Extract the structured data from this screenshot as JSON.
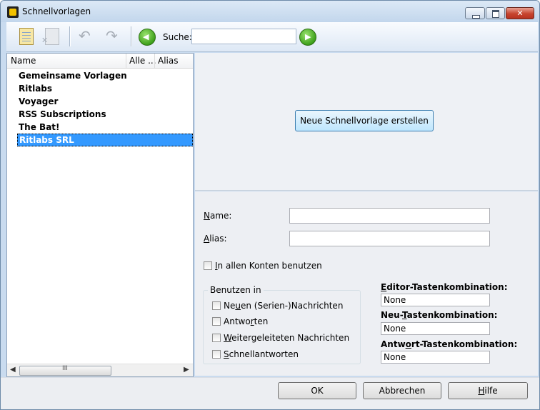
{
  "window": {
    "title": "Schnellvorlagen"
  },
  "toolbar": {
    "search_label": "Suche:",
    "search_value": ""
  },
  "columns": [
    "Name",
    "Alle ...",
    "Alias"
  ],
  "tree": [
    {
      "label": "Gemeinsame Vorlagen",
      "selected": false
    },
    {
      "label": "Ritlabs",
      "selected": false
    },
    {
      "label": "Voyager",
      "selected": false
    },
    {
      "label": "RSS Subscriptions",
      "selected": false
    },
    {
      "label": "The Bat!",
      "selected": false
    },
    {
      "label": "Ritlabs SRL",
      "selected": true
    }
  ],
  "scrollbar": {
    "grip": "III"
  },
  "create_button": "Neue Schnellvorlage erstellen",
  "form": {
    "name_label": "Name:",
    "name_value": "",
    "alias_label": "Alias:",
    "alias_value": "",
    "all_accounts": {
      "label": "In allen Konten benutzen",
      "checked": false
    },
    "use_in_title": "Benutzen in",
    "use_in": [
      {
        "label": "Neuen (Serien-)Nachrichten",
        "checked": false
      },
      {
        "label": "Antworten",
        "checked": false
      },
      {
        "label": "Weitergeleiteten Nachrichten",
        "checked": false
      },
      {
        "label": "Schnellantworten",
        "checked": false
      }
    ],
    "editor_shortcut_label": "Editor-Tastenkombination:",
    "editor_shortcut_value": "None",
    "new_shortcut_label": "Neu-Tastenkombination:",
    "new_shortcut_value": "None",
    "reply_shortcut_label": "Antwort-Tastenkombination:",
    "reply_shortcut_value": "None"
  },
  "buttons": {
    "ok": "OK",
    "cancel": "Abbrechen",
    "help": "Hilfe"
  },
  "colors": {
    "selection": "#3399ff",
    "accent_green": "#3ea11b",
    "window_frame": "#c9dbef"
  }
}
